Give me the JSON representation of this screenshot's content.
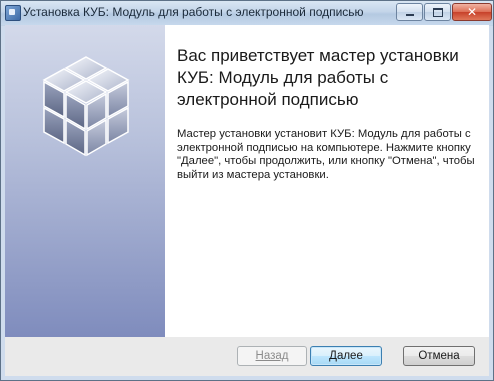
{
  "window": {
    "title": "Установка КУБ: Модуль для работы с электронной подписью",
    "controls": {
      "minimize": "minimize-icon",
      "maximize": "maximize-icon",
      "close": "close-icon"
    }
  },
  "welcome": {
    "heading": "Вас приветствует мастер установки КУБ: Модуль для работы с электронной подписью",
    "body": "Мастер установки установит КУБ: Модуль для работы с электронной подписью на компьютере. Нажмите кнопку \"Далее\", чтобы продолжить, или кнопку \"Отмена\", чтобы выйти из мастера установки."
  },
  "buttons": {
    "back_label": "Назад",
    "next_label": "Далее",
    "cancel_label": "Отмена"
  },
  "colors": {
    "side_panel_top": "#d3d9ea",
    "side_panel_bottom": "#7f8cbd",
    "default_button_border": "#3c7fb1"
  }
}
